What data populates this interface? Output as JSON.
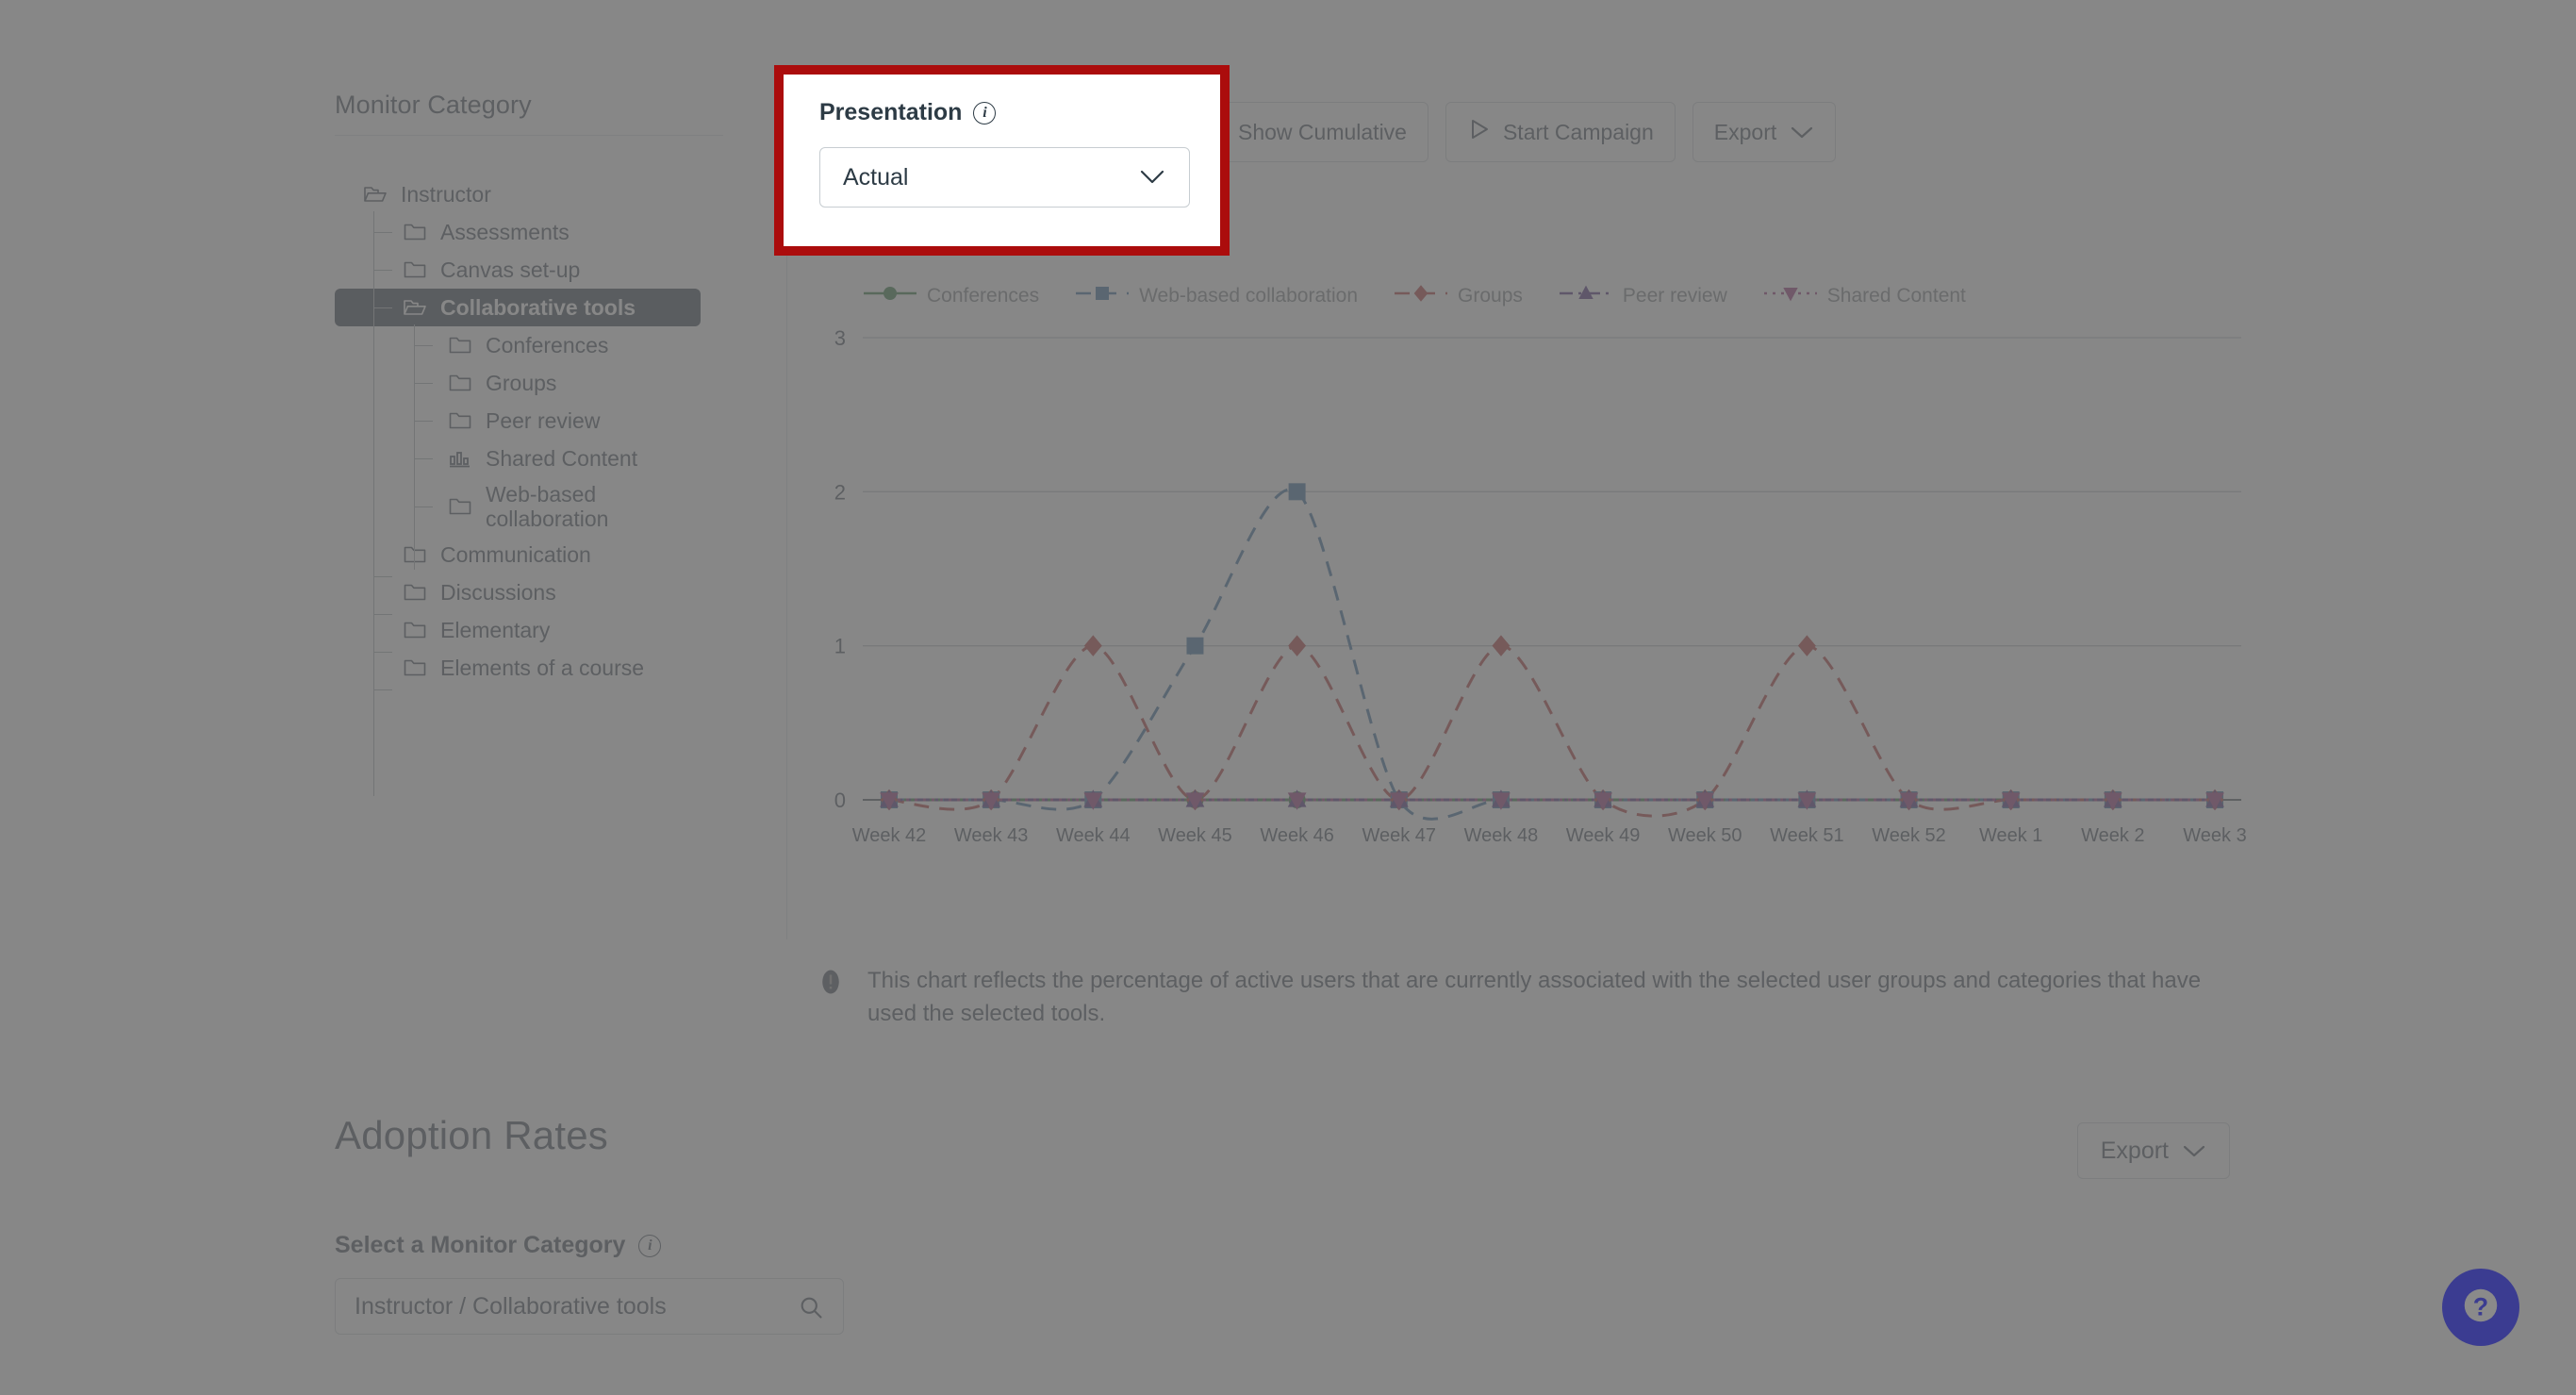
{
  "sidebar": {
    "title": "Monitor Category",
    "items": [
      {
        "label": "Instructor",
        "level": 0,
        "icon": "folder-open-icon",
        "selected": false
      },
      {
        "label": "Assessments",
        "level": 1,
        "icon": "folder-icon",
        "selected": false
      },
      {
        "label": "Canvas set-up",
        "level": 1,
        "icon": "folder-icon",
        "selected": false
      },
      {
        "label": "Collaborative tools",
        "level": 1,
        "icon": "folder-open-icon",
        "selected": true
      },
      {
        "label": "Conferences",
        "level": 2,
        "icon": "folder-icon",
        "selected": false
      },
      {
        "label": "Groups",
        "level": 2,
        "icon": "folder-icon",
        "selected": false
      },
      {
        "label": "Peer review",
        "level": 2,
        "icon": "folder-icon",
        "selected": false
      },
      {
        "label": "Shared Content",
        "level": 2,
        "icon": "bar-chart-icon",
        "selected": false
      },
      {
        "label": "Web-based collaboration",
        "level": 2,
        "icon": "folder-icon",
        "selected": false,
        "twoline": true
      },
      {
        "label": "Communication",
        "level": 1,
        "icon": "folder-icon",
        "selected": false
      },
      {
        "label": "Discussions",
        "level": 1,
        "icon": "folder-icon",
        "selected": false
      },
      {
        "label": "Elementary",
        "level": 1,
        "icon": "folder-icon",
        "selected": false
      },
      {
        "label": "Elements of a course",
        "level": 1,
        "icon": "folder-icon",
        "selected": false
      }
    ]
  },
  "callout": {
    "label": "Presentation",
    "info_icon": "info-icon",
    "selected_value": "Actual",
    "options": [
      "Actual"
    ],
    "chevron_icon": "chevron-down-icon",
    "highlight_color": "#ab0c0c"
  },
  "toolbar": {
    "buttons": [
      {
        "label": "Show Cumulative",
        "icon": "bar-chart-icon"
      },
      {
        "label": "Start Campaign",
        "icon": "play-icon"
      },
      {
        "label": "Export",
        "icon": "chevron-down-icon"
      }
    ]
  },
  "note": {
    "icon": "warning-icon",
    "text": "This chart reflects the percentage of active users that are currently associated with the selected user groups and categories that have used the selected tools."
  },
  "adoption": {
    "title": "Adoption Rates",
    "export_label": "Export",
    "export_icon": "chevron-down-icon",
    "field_label": "Select a Monitor Category",
    "field_info_icon": "info-icon",
    "search_value": "Instructor / Collaborative tools",
    "search_placeholder": "Instructor / Collaborative tools",
    "search_icon": "search-icon"
  },
  "help": {
    "icon": "question-mark-icon",
    "color": "#3b3c91"
  },
  "chart_data": {
    "type": "line",
    "title": "",
    "xlabel": "",
    "ylabel": "",
    "ylim": [
      0,
      3
    ],
    "yticks": [
      0,
      1,
      2,
      3
    ],
    "grid": true,
    "legend_position": "top-left",
    "categories": [
      "Week 42",
      "Week 43",
      "Week 44",
      "Week 45",
      "Week 46",
      "Week 47",
      "Week 48",
      "Week 49",
      "Week 50",
      "Week 51",
      "Week 52",
      "Week 1",
      "Week 2",
      "Week 3"
    ],
    "series": [
      {
        "name": "Conferences",
        "color": "#1a6b2a",
        "marker": "circle",
        "dash": "solid",
        "values": [
          0,
          0,
          0,
          0,
          0,
          0,
          0,
          0,
          0,
          0,
          0,
          0,
          0,
          0
        ]
      },
      {
        "name": "Web-based collaboration",
        "color": "#215c8f",
        "marker": "square",
        "dash": "dashed",
        "values": [
          0,
          0,
          0,
          1,
          2,
          0,
          0,
          0,
          0,
          0,
          0,
          0,
          0,
          0
        ]
      },
      {
        "name": "Groups",
        "color": "#a81f1f",
        "marker": "diamond",
        "dash": "dashed",
        "values": [
          0,
          0,
          1,
          0,
          1,
          0,
          1,
          0,
          0,
          1,
          0,
          0,
          0,
          0
        ]
      },
      {
        "name": "Peer review",
        "color": "#3b1270",
        "marker": "triangle-up",
        "dash": "dashdot",
        "values": [
          0,
          0,
          0,
          0,
          0,
          0,
          0,
          0,
          0,
          0,
          0,
          0,
          0,
          0
        ]
      },
      {
        "name": "Shared Content",
        "color": "#8e1b6b",
        "marker": "triangle-down",
        "dash": "dotted",
        "values": [
          0,
          0,
          0,
          0,
          0,
          0,
          0,
          0,
          0,
          0,
          0,
          0,
          0,
          0
        ]
      }
    ]
  }
}
